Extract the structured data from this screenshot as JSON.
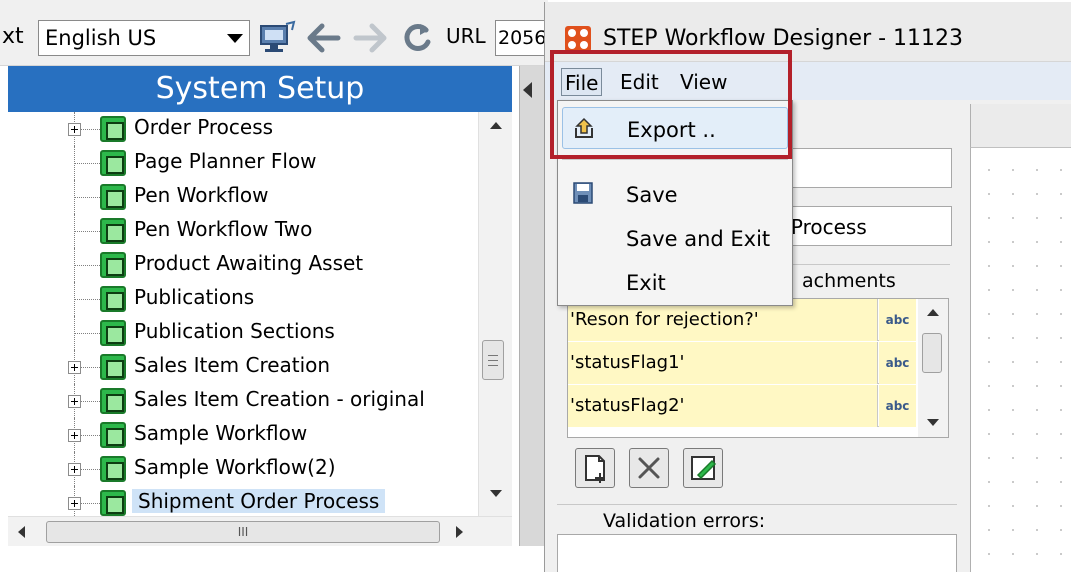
{
  "toolbar": {
    "context_label_fragment": "xt",
    "language_value": "English US",
    "url_label": "URL",
    "url_value_fragment": "2056"
  },
  "system_setup": {
    "title": "System Setup",
    "items": [
      {
        "label": "Order Process",
        "expandable": true,
        "selected": false
      },
      {
        "label": "Page Planner Flow",
        "expandable": false,
        "selected": false
      },
      {
        "label": "Pen Workflow",
        "expandable": false,
        "selected": false
      },
      {
        "label": "Pen Workflow Two",
        "expandable": false,
        "selected": false
      },
      {
        "label": "Product Awaiting Asset",
        "expandable": false,
        "selected": false
      },
      {
        "label": "Publications",
        "expandable": false,
        "selected": false
      },
      {
        "label": "Publication Sections",
        "expandable": false,
        "selected": false
      },
      {
        "label": "Sales Item Creation",
        "expandable": true,
        "selected": false
      },
      {
        "label": "Sales Item Creation - original",
        "expandable": true,
        "selected": false
      },
      {
        "label": "Sample Workflow",
        "expandable": true,
        "selected": false
      },
      {
        "label": "Sample Workflow(2)",
        "expandable": true,
        "selected": false
      },
      {
        "label": "Shipment Order Process",
        "expandable": true,
        "selected": true
      }
    ],
    "hscroll_grip": "III"
  },
  "designer": {
    "title": "STEP Workflow Designer - 11123",
    "menu": {
      "file": "File",
      "edit": "Edit",
      "view": "View"
    },
    "file_menu": {
      "export": "Export ..",
      "save": "Save",
      "save_and_exit": "Save and Exit",
      "exit": "Exit"
    },
    "form": {
      "name_value_fragment": "er Process",
      "attachments_label_fragment": "achments",
      "attachments": [
        {
          "name": "'Reson for rejection?'",
          "type": "abc"
        },
        {
          "name": "'statusFlag1'",
          "type": "abc"
        },
        {
          "name": "'statusFlag2'",
          "type": "abc"
        }
      ],
      "validation_label": "Validation errors:"
    }
  },
  "colors": {
    "header_blue": "#2870c0",
    "highlight_red": "#b3202a",
    "attachment_yellow": "#fff8c4",
    "selected_bg": "#cfe3f7"
  }
}
